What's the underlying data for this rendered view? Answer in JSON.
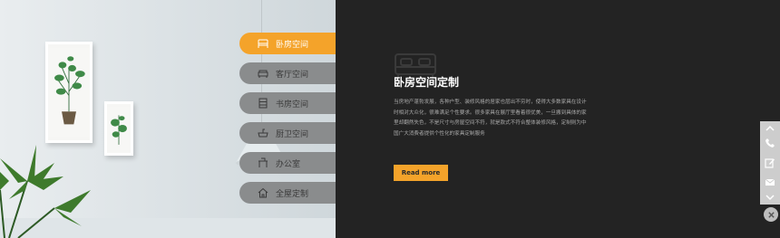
{
  "menu": {
    "items": [
      {
        "label": "卧房空间",
        "icon": "bed-icon",
        "active": true
      },
      {
        "label": "客厅空间",
        "icon": "sofa-icon",
        "active": false
      },
      {
        "label": "书房空间",
        "icon": "bookshelf-icon",
        "active": false
      },
      {
        "label": "厨卫空间",
        "icon": "sink-icon",
        "active": false
      },
      {
        "label": "办公室",
        "icon": "office-desk-icon",
        "active": false
      },
      {
        "label": "全屋定制",
        "icon": "house-icon",
        "active": false
      }
    ]
  },
  "content": {
    "title": "卧房空间定制",
    "description": "当房地产蓬勃发展，各种户型、装修风格的居家也层出不穷时，使得大多数家具在设计时相对大众化，很难满足个性要求。很多家具在展厅里看着很优美，一旦搬到具体的家里却翻然失色，不是尺寸与房屋空间不符，就是款式不符合整体装修风格，定制则为中国广大消费者提供个性化的家具定制服务",
    "read_more": "Read more"
  },
  "sidebar": {
    "buttons": [
      "up-arrow-icon",
      "phone-icon",
      "edit-icon",
      "mail-icon",
      "down-arrow-icon"
    ],
    "close": "close-icon"
  },
  "colors": {
    "accent": "#f4a32a",
    "menu_inactive": "#8a8c8d",
    "background": "#232323"
  }
}
